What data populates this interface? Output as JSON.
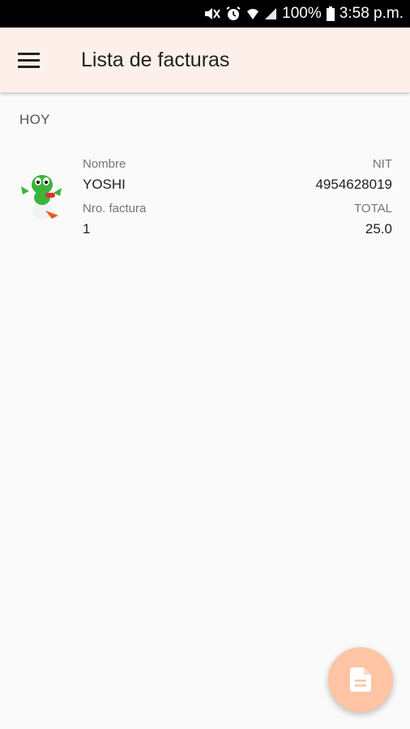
{
  "status_bar": {
    "battery": "100%",
    "time": "3:58 p.m."
  },
  "app_bar": {
    "title": "Lista de facturas"
  },
  "section": {
    "header": "HOY"
  },
  "invoices": [
    {
      "nombre_label": "Nombre",
      "nombre": "YOSHI",
      "nit_label": "NIT",
      "nit": "4954628019",
      "factura_label": "Nro. factura",
      "factura": "1",
      "total_label": "TOTAL",
      "total": "25.0"
    }
  ],
  "icons": {
    "menu": "menu-icon",
    "fab": "document-icon",
    "avatar": "yoshi-avatar"
  },
  "colors": {
    "app_bar": "#fdf0eb",
    "fab": "#ffc4a4",
    "status_bar": "#000000"
  }
}
